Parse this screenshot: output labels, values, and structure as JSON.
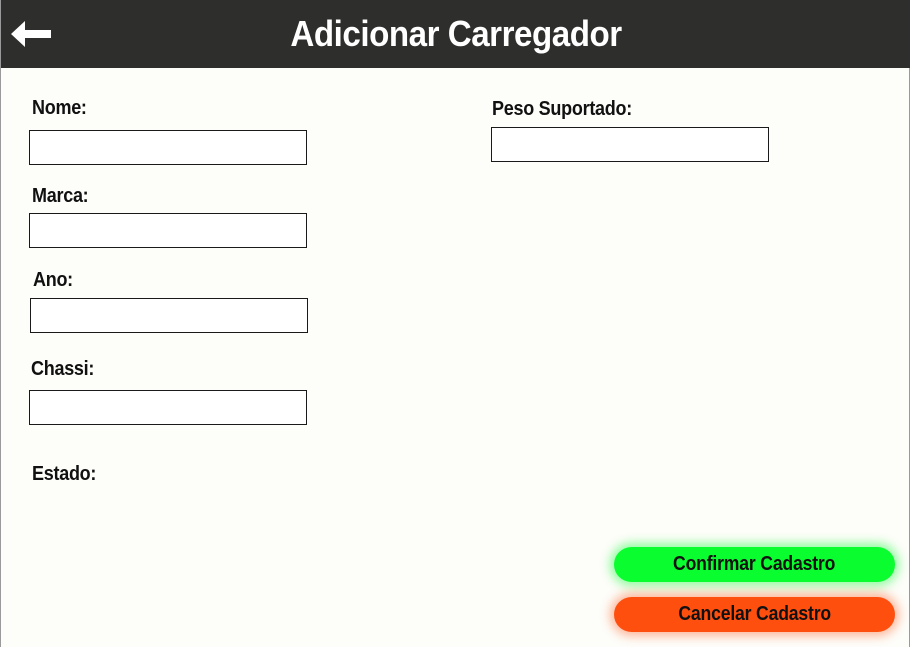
{
  "header": {
    "title": "Adicionar Carregador",
    "back_icon": "arrow-left-icon"
  },
  "form": {
    "nome_label": "Nome:",
    "marca_label": "Marca:",
    "ano_label": "Ano:",
    "chassi_label": "Chassi:",
    "estado_label": "Estado:",
    "peso_label": "Peso Suportado:",
    "nome_value": "",
    "marca_value": "",
    "ano_value": "",
    "chassi_value": "",
    "peso_value": ""
  },
  "actions": {
    "confirm_label": "Confirmar Cadastro",
    "cancel_label": "Cancelar Cadastro"
  },
  "colors": {
    "header_bg": "#2e2e2c",
    "confirm": "#0afd2e",
    "cancel": "#ff4f0f",
    "page_bg": "#fdfdf9"
  }
}
